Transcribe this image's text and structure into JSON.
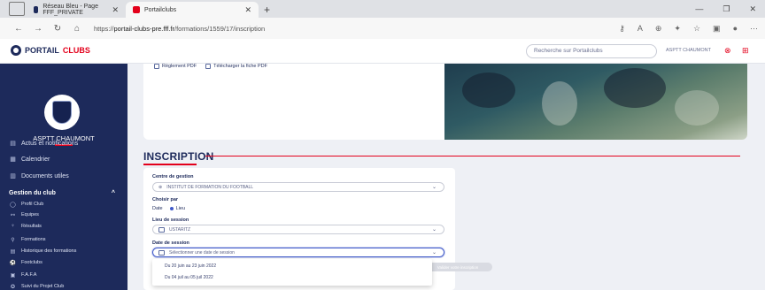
{
  "browser": {
    "tabs": [
      {
        "label": "Réseau Bleu - Page FFF_PRIVATE",
        "active": false
      },
      {
        "label": "Portailclubs",
        "active": true
      }
    ],
    "url_prefix": "https://",
    "url_host": "portail-clubs-pre.fff.fr",
    "url_path": "/formations/1559/17/inscription",
    "new_tab_label": "+"
  },
  "header": {
    "logo_text_a": "PORTAIL",
    "logo_text_b": "CLUBS",
    "search_placeholder": "Recherche sur Portailclubs",
    "club_name": "ASPTT CHAUMONT"
  },
  "sidebar": {
    "club_title": "ASPTT CHAUMONT",
    "items": [
      {
        "label": "Actus et notifications",
        "icon": "news-icon"
      },
      {
        "label": "Calendrier",
        "icon": "calendar-icon"
      },
      {
        "label": "Documents utiles",
        "icon": "documents-icon"
      }
    ],
    "group": {
      "label": "Gestion du club",
      "caret": "^"
    },
    "sub_items": [
      {
        "label": "Profil Club",
        "icon": "club-icon"
      },
      {
        "label": "Equipes",
        "icon": "teams-icon"
      },
      {
        "label": "Résultats",
        "icon": "results-icon"
      },
      {
        "label": "Formations",
        "icon": "training-icon"
      },
      {
        "label": "Historique des formations",
        "icon": "history-icon"
      },
      {
        "label": "Footclubs",
        "icon": "footclubs-icon"
      },
      {
        "label": "F.A.F.A",
        "icon": "fafa-icon"
      },
      {
        "label": "Suivi du Projet Club",
        "icon": "project-icon"
      }
    ]
  },
  "docs": {
    "reglement": "Règlement PDF",
    "fiche": "Télécharger la fiche PDF"
  },
  "inscription": {
    "title": "INSCRIPTION",
    "centre_label": "Centre de gestion",
    "centre_value": "INSTITUT DE FORMATION DU FOOTBALL",
    "choisir_label": "Choisir par",
    "opt_date": "Date",
    "opt_lieu": "Lieu",
    "lieu_label": "Lieu de session",
    "lieu_value": "USTARITZ",
    "date_label": "Date de session",
    "date_placeholder": "Sélectionner une date de session",
    "options": [
      "Du 20 juin au 23 juin 2022",
      "Du 04 juil au 05 juil 2022"
    ],
    "continue_label": "Valider votre inscription"
  }
}
